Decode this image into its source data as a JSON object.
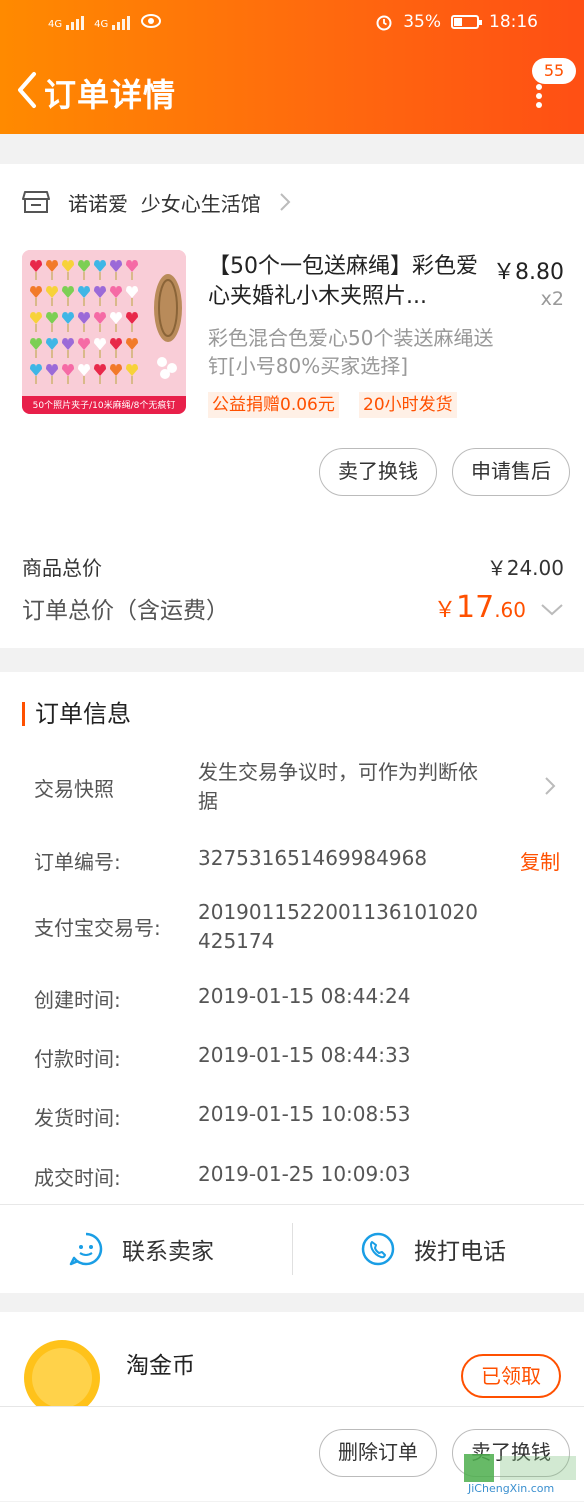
{
  "status_bar": {
    "signal": "4G",
    "battery": "35%",
    "battery_level": 0.35,
    "time": "18:16"
  },
  "header": {
    "title": "订单详情",
    "badge": "55"
  },
  "shop": {
    "name": "诺诺爱  少女心生活馆"
  },
  "product": {
    "title": "【50个一包送麻绳】彩色爱心夹婚礼小木夹照片...",
    "price": "￥8.80",
    "quantity": "x2",
    "spec": "彩色混合色爱心50个装送麻绳送钉[小号80%买家选择]",
    "tag_charity": "公益捐赠0.06元",
    "tag_shipping": "20小时发货",
    "image_caption": "50个照片夹子/10米麻绳/8个无痕钉"
  },
  "actions": {
    "sell_exchange": "卖了换钱",
    "after_sale": "申请售后"
  },
  "summary": {
    "goods_total_label": "商品总价",
    "goods_total_value": "￥24.00",
    "order_total_label": "订单总价（含运费）",
    "order_total_symbol": "￥",
    "order_total_int": "17",
    "order_total_dec": ".60"
  },
  "order_info": {
    "title": "订单信息",
    "rows": [
      {
        "label": "交易快照",
        "value": "发生交易争议时，可作为判断依据"
      },
      {
        "label": "订单编号:",
        "value": "327531651469984968",
        "action": "复制"
      },
      {
        "label": "支付宝交易号:",
        "value": "2019011522001136101020425174"
      },
      {
        "label": "创建时间:",
        "value": "2019-01-15 08:44:24"
      },
      {
        "label": "付款时间:",
        "value": "2019-01-15 08:44:33"
      },
      {
        "label": "发货时间:",
        "value": "2019-01-15 10:08:53"
      },
      {
        "label": "成交时间:",
        "value": "2019-01-25 10:09:03"
      }
    ]
  },
  "contact": {
    "seller": "联系卖家",
    "phone": "拨打电话"
  },
  "coin": {
    "title": "淘金币",
    "button": "已领取"
  },
  "bottom": {
    "delete": "删除订单",
    "sell_exchange": "卖了换钱"
  },
  "watermark": {
    "text": "JiChengXin.com"
  },
  "colors": {
    "accent": "#ff5000",
    "header_start": "#ff8a00",
    "header_end": "#ff4f14",
    "blue_icon": "#1a9ee5"
  }
}
